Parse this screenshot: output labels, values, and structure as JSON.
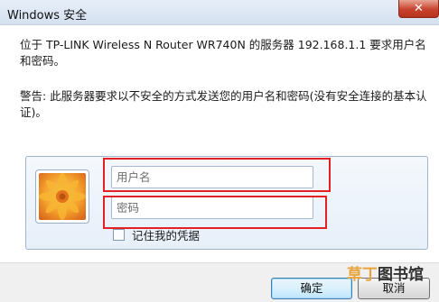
{
  "window": {
    "title": "Windows 安全",
    "close_glyph": "✕"
  },
  "message": {
    "description": "位于 TP-LINK Wireless N Router WR740N 的服务器 192.168.1.1 要求用户名和密码。",
    "warning": "警告: 此服务器要求以不安全的方式发送您的用户名和密码(没有安全连接的基本认证)。"
  },
  "credentials": {
    "username_placeholder": "用户名",
    "username_value": "",
    "password_placeholder": "密码",
    "password_value": "",
    "remember_label": "记住我的凭据",
    "remember_checked": false,
    "avatar_icon": "flower-icon"
  },
  "buttons": {
    "ok_label": "确定",
    "cancel_label": "取消"
  },
  "watermark": {
    "part1": "草丁",
    "part2": "图书馆"
  },
  "colors": {
    "highlight": "#e51f26",
    "close_button": "#c7432d",
    "titlebar": "#d5e1f0"
  }
}
